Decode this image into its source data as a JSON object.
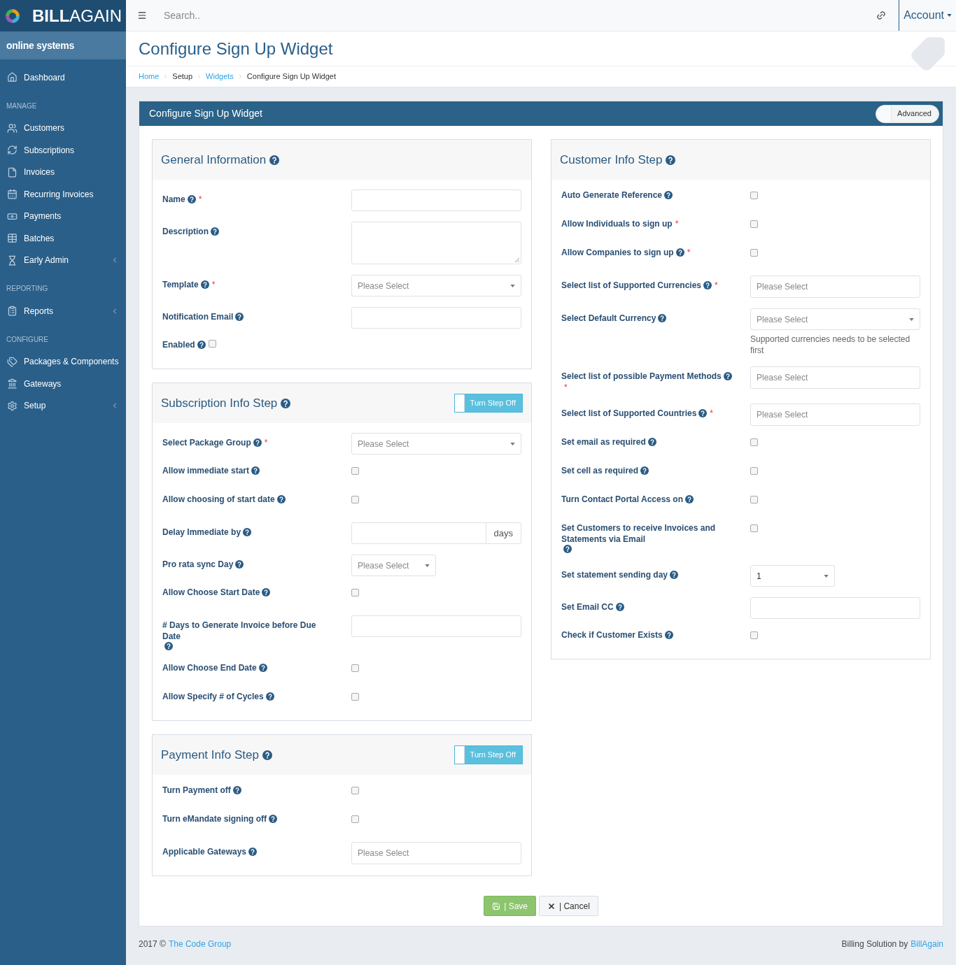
{
  "brand": {
    "logo_text": "**BILL**AGAIN",
    "org": "online systems"
  },
  "sidebar": {
    "groups": [
      {
        "items": [
          {
            "label": "Dashboard",
            "expandable": false
          }
        ]
      },
      {
        "heading": "MANAGE",
        "items": [
          {
            "label": "Customers",
            "expandable": false
          },
          {
            "label": "Subscriptions",
            "expandable": false
          },
          {
            "label": "Invoices",
            "expandable": false
          },
          {
            "label": "Recurring Invoices",
            "expandable": false
          },
          {
            "label": "Payments",
            "expandable": false
          },
          {
            "label": "Batches",
            "expandable": false
          },
          {
            "label": "Early Admin",
            "expandable": true
          }
        ]
      },
      {
        "heading": "REPORTING",
        "items": [
          {
            "label": "Reports",
            "expandable": true
          }
        ]
      },
      {
        "heading": "CONFIGURE",
        "items": [
          {
            "label": "Packages & Components",
            "expandable": false
          },
          {
            "label": "Gateways",
            "expandable": false
          },
          {
            "label": "Setup",
            "expandable": true
          }
        ]
      }
    ]
  },
  "topbar": {
    "search": {
      "placeholder": "Search.."
    },
    "account": "Account"
  },
  "page": {
    "title": "Configure Sign Up Widget",
    "breadcrumb": [
      {
        "label": "Home",
        "link": true
      },
      {
        "label": "Setup",
        "link": false
      },
      {
        "label": "Widgets",
        "link": true
      },
      {
        "label": "Configure Sign Up Widget",
        "link": false
      }
    ]
  },
  "panel": {
    "title": "Configure Sign Up Widget",
    "advanced": {
      "label": "Advanced",
      "on": false
    }
  },
  "columns": [
    [
      {
        "title": "General Information",
        "fields": [
          {
            "label": "Name",
            "help": true,
            "mark": "*",
            "kind": "text"
          },
          {
            "label": "Description",
            "help": true,
            "kind": "textarea"
          },
          {
            "label": "Template",
            "help": true,
            "mark": "*",
            "kind": "select",
            "placeholder": "Please Select"
          },
          {
            "label": "Notification Email",
            "help": true,
            "kind": "text"
          },
          {
            "label": "Enabled",
            "help": true,
            "kind": "inline_checkbox",
            "checked": false
          }
        ]
      },
      {
        "title": "Subscription Info Step",
        "toggle": {
          "label": "Turn Step Off",
          "on": true
        },
        "fields": [
          {
            "label": "Select Package Group",
            "help": true,
            "mark": "*",
            "kind": "select",
            "placeholder": "Please Select"
          },
          {
            "label": "Allow immediate start",
            "help": true,
            "kind": "checkbox",
            "checked": false
          },
          {
            "label": "Allow choosing of start date",
            "help": true,
            "kind": "checkbox",
            "checked": false
          },
          {
            "label": "Delay Immediate by",
            "help": true,
            "kind": "addon",
            "addon": "days"
          },
          {
            "label": "Pro rata sync Day",
            "help": true,
            "kind": "short_select",
            "placeholder": "Please Select"
          },
          {
            "label": "Allow Choose Start Date",
            "help": true,
            "kind": "checkbox",
            "checked": false
          },
          {
            "label": "# Days to Generate Invoice before Due Date",
            "help": true,
            "kind": "text"
          },
          {
            "label": "Allow Choose End Date",
            "help": true,
            "kind": "checkbox",
            "checked": false
          },
          {
            "label": "Allow Specify # of Cycles",
            "help": true,
            "kind": "checkbox",
            "checked": false
          }
        ]
      },
      {
        "title": "Payment Info Step",
        "toggle": {
          "label": "Turn Step Off",
          "on": true
        },
        "fields": [
          {
            "label": "Turn Payment off",
            "help": true,
            "kind": "checkbox",
            "checked": false
          },
          {
            "label": "Turn eMandate signing off",
            "help": true,
            "kind": "checkbox",
            "checked": false
          },
          {
            "label": "Applicable Gateways",
            "help": true,
            "kind": "multiselect",
            "placeholder": "Please Select"
          }
        ]
      }
    ],
    [
      {
        "title": "Customer Info Step",
        "fields": [
          {
            "label": "Auto Generate Reference",
            "help": true,
            "kind": "checkbox",
            "checked": false
          },
          {
            "label": "Allow Individuals to sign up",
            "help": false,
            "mark": "*",
            "kind": "checkbox",
            "checked": false
          },
          {
            "label": "Allow Companies to sign up",
            "help": true,
            "mark": "*",
            "kind": "checkbox",
            "checked": false
          },
          {
            "label": "Select list of Supported Currencies",
            "help": true,
            "mark": "*",
            "kind": "multiselect",
            "placeholder": "Please Select"
          },
          {
            "label": "Select Default Currency",
            "help": true,
            "kind": "select",
            "placeholder": "Please Select",
            "note": "Supported currencies needs to be selected first"
          },
          {
            "label": "Select list of possible Payment Methods",
            "help": true,
            "mark": "*",
            "kind": "multiselect",
            "placeholder": "Please Select"
          },
          {
            "label": "Select list of Supported Countries",
            "help": true,
            "mark": "*",
            "kind": "multiselect",
            "placeholder": "Please Select"
          },
          {
            "label": "Set email as required",
            "help": true,
            "kind": "checkbox",
            "checked": false
          },
          {
            "label": "Set cell as required",
            "help": true,
            "kind": "checkbox",
            "checked": false
          },
          {
            "label": "Turn Contact Portal Access on",
            "help": true,
            "kind": "checkbox",
            "checked": false
          },
          {
            "label": "Set Customers to receive Invoices and Statements via Email",
            "help": true,
            "kind": "checkbox",
            "checked": false
          },
          {
            "label": "Set statement sending day",
            "help": true,
            "kind": "short_select",
            "value": "1"
          },
          {
            "label": "Set Email CC",
            "help": true,
            "kind": "text"
          },
          {
            "label": "Check if Customer Exists",
            "help": true,
            "kind": "checkbox",
            "checked": false
          }
        ]
      }
    ]
  ],
  "actions": [
    {
      "kind": "save",
      "label": "| Save"
    },
    {
      "kind": "cancel",
      "label": "| Cancel"
    }
  ],
  "footer": {
    "left_text": "2017 ©",
    "left_link": "The Code Group",
    "right_text": "Billing Solution by",
    "right_link": "BillAgain"
  }
}
